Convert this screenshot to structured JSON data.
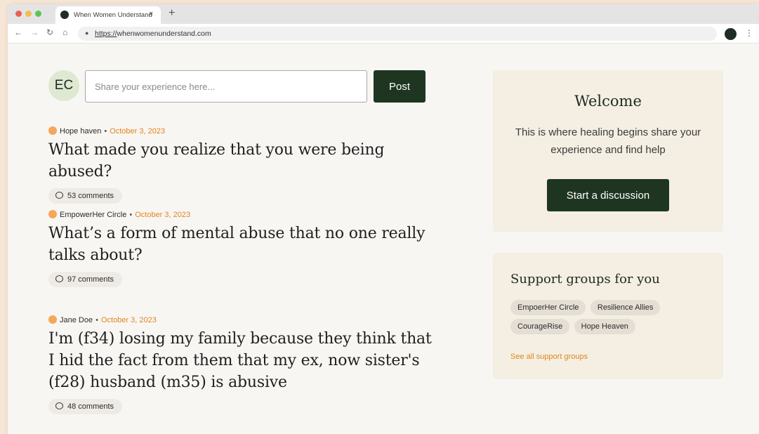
{
  "browser": {
    "tab_title": "When Women Understand",
    "tab_close": "×",
    "new_tab": "+",
    "url_protocol": "https://",
    "url_rest": "whenwomenunderstand.com"
  },
  "composer": {
    "avatar_initials": "EC",
    "placeholder": "Share your experience here...",
    "post_label": "Post"
  },
  "posts": [
    {
      "group": "Hope haven",
      "date": "October 3, 2023",
      "title": "What made you realize that you were being abused?",
      "comments": "53 comments"
    },
    {
      "group": "EmpowerHer Circle",
      "date": "October 3, 2023",
      "title": "What’s a form of mental abuse that no one really talks about?",
      "comments": "97 comments"
    },
    {
      "group": "Jane Doe",
      "date": "October 3, 2023",
      "title": "I'm (f34) losing my family because they think that I hid the fact from them that my ex, now sister's (f28) husband (m35) is abusive",
      "comments": "48 comments"
    }
  ],
  "welcome": {
    "title": "Welcome",
    "text": "This is where healing begins share your experience and find help",
    "button": "Start a discussion"
  },
  "support": {
    "title": "Support groups for you",
    "groups": [
      "EmpoerHer Circle",
      "Resilience Allies",
      "CourageRise",
      "Hope Heaven"
    ],
    "see_all": "See all support groups"
  },
  "colors": {
    "accent_green": "#1e3621",
    "date_orange": "#e0861e",
    "group_dot": "#f3a75b",
    "card_bg": "#f4efe2"
  },
  "icons": [
    "close-icon",
    "plus-icon",
    "back-icon",
    "forward-icon",
    "reload-icon",
    "home-icon",
    "lock-icon",
    "star-icon",
    "menu-icon",
    "comment-bubble-icon"
  ]
}
